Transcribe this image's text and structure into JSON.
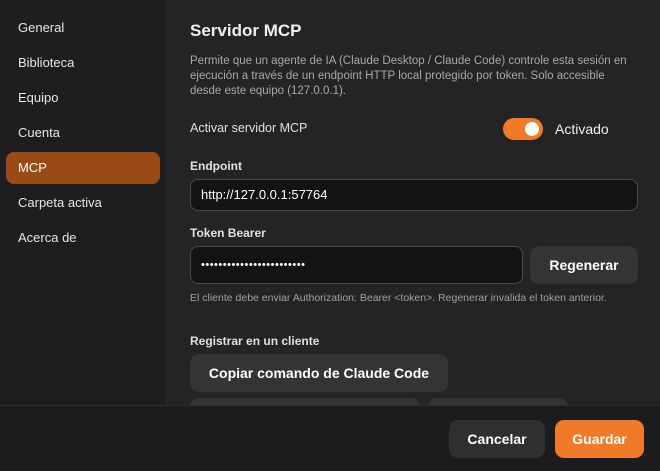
{
  "sidebar": {
    "items": [
      {
        "label": "General"
      },
      {
        "label": "Biblioteca"
      },
      {
        "label": "Equipo"
      },
      {
        "label": "Cuenta"
      },
      {
        "label": "MCP"
      },
      {
        "label": "Carpeta activa"
      },
      {
        "label": "Acerca de"
      }
    ],
    "active": "MCP"
  },
  "main": {
    "title": "Servidor MCP",
    "description": "Permite que un agente de IA (Claude Desktop / Claude Code) controle esta sesión en ejecución a través de un endpoint HTTP local protegido por token. Solo accesible desde este equipo (127.0.0.1).",
    "enable_label": "Activar servidor MCP",
    "toggle": {
      "on": true,
      "label": "Activado"
    },
    "endpoint": {
      "label": "Endpoint",
      "value": "http://127.0.0.1:57764"
    },
    "token": {
      "label": "Token Bearer",
      "value": "••••••••••••••••••••••••",
      "regenerate_label": "Regenerar"
    },
    "hint": "El cliente debe enviar Authorization: Bearer <token>. Regenerar invalida el token anterior.",
    "register": {
      "label": "Registrar en un cliente",
      "copy_claude_code_label": "Copiar comando de Claude Code"
    }
  },
  "footer": {
    "cancel_label": "Cancelar",
    "save_label": "Guardar"
  },
  "colors": {
    "accent": "#f07a28",
    "active_nav": "#9a4a15"
  }
}
